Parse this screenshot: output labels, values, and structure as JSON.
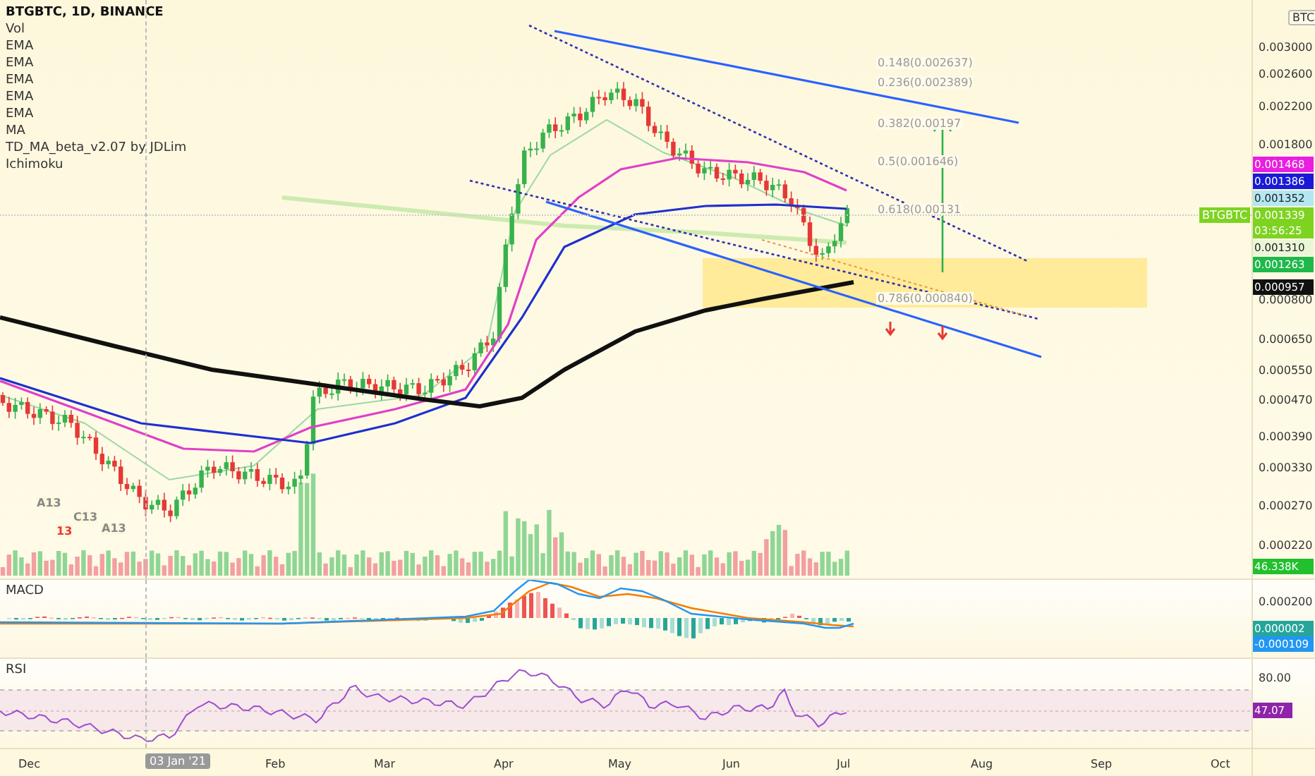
{
  "legend": {
    "title": "BTGBTC, 1D, BINANCE",
    "indicators": [
      "Vol",
      "EMA",
      "EMA",
      "EMA",
      "EMA",
      "EMA",
      "MA",
      "TD_MA_beta_v2.07 by JDLim",
      "Ichimoku"
    ]
  },
  "price_axis": {
    "unit": "BTC",
    "ticks": [
      "0.003000",
      "0.002600",
      "0.002200",
      "0.001800",
      "0.000800",
      "0.000650",
      "0.000550",
      "0.000470",
      "0.000390",
      "0.000330",
      "0.000270",
      "0.000220"
    ]
  },
  "price_tags": [
    {
      "value": "0.001468",
      "color": "#e91ee0"
    },
    {
      "value": "0.001386",
      "color": "#1a1ad6"
    },
    {
      "value": "0.001352",
      "color": "#b3e7f2"
    },
    {
      "symbol": "BTGBTC",
      "value": "0.001339",
      "countdown": "03:56:25",
      "color": "#7ed321"
    },
    {
      "value": "0.001310",
      "color": "#eaf6d8"
    },
    {
      "value": "0.001263",
      "color": "#1fb84a"
    },
    {
      "value": "0.000957",
      "color": "#111111"
    }
  ],
  "volume_tag": {
    "value": "46.338K",
    "color": "#22c02e"
  },
  "fib_levels": [
    "0.148(0.002637)",
    "0.236(0.002389)",
    "0.382(0.00197",
    "0.5(0.001646)",
    "0.618(0.00131",
    "0.786(0.000840)"
  ],
  "chart_marks": [
    {
      "text": "A13",
      "color": "#888888"
    },
    {
      "text": "C13",
      "color": "#888888"
    },
    {
      "text": "A13",
      "color": "#888888"
    },
    {
      "text": "13",
      "color": "#e53935"
    }
  ],
  "macd": {
    "title": "MACD",
    "axis_ticks": [
      "0.000200"
    ],
    "tags": [
      {
        "value": "0.000002",
        "color": "#26a69a"
      },
      {
        "value": "-0.000109",
        "color": "#2196f3"
      }
    ]
  },
  "rsi": {
    "title": "RSI",
    "axis_ticks": [
      "80.00"
    ],
    "tag": {
      "value": "47.07",
      "color": "#8e24aa"
    }
  },
  "time_axis": [
    {
      "label": "Dec",
      "selected": false
    },
    {
      "label": "03 Jan '21",
      "selected": true
    },
    {
      "label": "Feb",
      "selected": false
    },
    {
      "label": "Mar",
      "selected": false
    },
    {
      "label": "Apr",
      "selected": false
    },
    {
      "label": "May",
      "selected": false
    },
    {
      "label": "Jun",
      "selected": false
    },
    {
      "label": "Jul",
      "selected": false
    },
    {
      "label": "Aug",
      "selected": false
    },
    {
      "label": "Sep",
      "selected": false
    },
    {
      "label": "Oct",
      "selected": false
    }
  ]
}
